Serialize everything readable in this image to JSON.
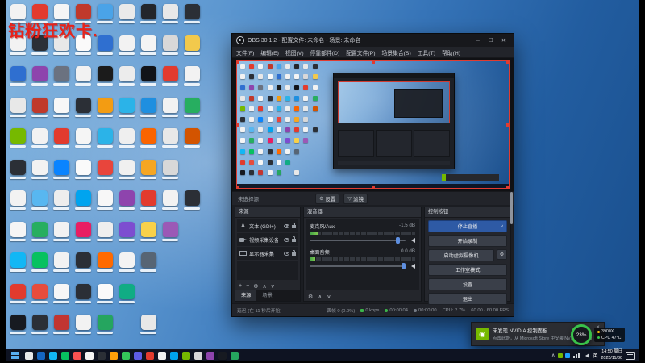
{
  "overlay": {
    "promo_text": "钻粉狂欢卡."
  },
  "desktop": {
    "icon_rows": [
      [
        "#f2f2f2",
        "#e23b2e",
        "#f5f5f5",
        "#c0392b",
        "#4aa3e8",
        "#eaeaea",
        "#23262b",
        "#e8e8e8",
        "#2b2f36",
        null
      ],
      [
        "#f2f2f2",
        "#2b2f36",
        "#e8e8e8",
        "#fafafa",
        "#2f6fd0",
        "#f2f2f2",
        "#f4f4f4",
        "#d8d8d8",
        "#f2c94c",
        null
      ],
      [
        "#2f6fd0",
        "#8e44ad",
        "#6b7280",
        "#f2f2f2",
        "#1b1b1b",
        "#ececec",
        "#111318",
        "#e23b2e",
        "#f2f2f2",
        null
      ],
      [
        "#e8e8e8",
        "#c0392b",
        "#f7f7f7",
        "#2b2f36",
        "#f39c12",
        "#2bb3e8",
        "#1f8fe0",
        "#f2f2f2",
        "#27ae60",
        null
      ],
      [
        "#76b900",
        "#f2f2f2",
        "#e23b2e",
        "#f5f5f5",
        "#2bb3e8",
        "#efefef",
        "#fa6400",
        "#e8e8e8",
        "#d35400",
        null
      ],
      [
        "#2b2f36",
        "#f2f2f2",
        "#0a84ff",
        "#fafafa",
        "#e8453c",
        "#f0f0f0",
        "#f5a623",
        "#d8d8d8",
        null,
        null
      ],
      [
        "#f2f2f2",
        "#58b7f0",
        "#ededed",
        "#00a4ef",
        "#f7f7f7",
        "#8e44ad",
        "#e23b2e",
        "#f2f2f2",
        "#2b2f36",
        null
      ],
      [
        "#f5f5f5",
        "#27ae60",
        "#f2f2f2",
        "#e91e63",
        "#eeeeee",
        "#7d4dd0",
        "#f8d14a",
        "#9b59b6",
        null,
        null
      ],
      [
        "#12b7f5",
        "#07c160",
        "#f2f2f2",
        "#2b2f36",
        "#ff6a00",
        "#f3f3f3",
        "#576574",
        null,
        null,
        null
      ],
      [
        "#e23b2e",
        "#e74c3c",
        "#f6f6f6",
        "#2b2f36",
        "#fafafa",
        "#10ac84",
        null,
        null,
        null,
        null
      ],
      [
        "#171a21",
        "#2b2f36",
        "#c23531",
        "#f2f2f2",
        "#25a55f",
        null,
        "#e8e8e8",
        null,
        null,
        null
      ]
    ]
  },
  "obs": {
    "title": "OBS 30.1.2 - 配置文件: 未命名 - 场景: 未命名",
    "window_controls": [
      {
        "name": "minimize-button",
        "glyph": "─"
      },
      {
        "name": "maximize-button",
        "glyph": "☐"
      },
      {
        "name": "close-button",
        "glyph": "✕"
      }
    ],
    "menu": [
      "文件(F)",
      "编辑(E)",
      "视图(V)",
      "停靠部件(D)",
      "配置文件(P)",
      "场景集合(S)",
      "工具(T)",
      "帮助(H)"
    ],
    "preview": {
      "no_source": "未选择源",
      "buttons": [
        {
          "name": "properties-button",
          "glyph": "⚙",
          "label": "设置"
        },
        {
          "name": "filters-button",
          "glyph": "▽",
          "label": "滤镜"
        }
      ]
    },
    "sources": {
      "title": "来源",
      "items": [
        {
          "icon": "text-source-icon",
          "type": "text",
          "label": "文本 (GDI+)"
        },
        {
          "icon": "camera-source-icon",
          "type": "cam",
          "label": "视频采集设备"
        },
        {
          "icon": "display-source-icon",
          "type": "display",
          "label": "显示器采集"
        }
      ],
      "toolbar": [
        {
          "name": "add-source-icon",
          "glyph": "+"
        },
        {
          "name": "remove-source-icon",
          "glyph": "−"
        },
        {
          "name": "source-properties-icon",
          "glyph": "⚙"
        },
        {
          "name": "move-source-up-icon",
          "glyph": "∧"
        },
        {
          "name": "move-source-down-icon",
          "glyph": "∨"
        }
      ],
      "tabs": [
        {
          "label": "来源",
          "active": true
        },
        {
          "label": "场景",
          "active": false
        }
      ]
    },
    "mixer": {
      "title": "混音器",
      "channels": [
        {
          "name": "麦克风/Aux",
          "db": "-1.5 dB",
          "meter": 8,
          "slider": 90
        },
        {
          "name": "桌面音频",
          "db": "0.0 dB",
          "meter": 5,
          "slider": 96
        }
      ],
      "toolbar": [
        {
          "name": "mixer-settings-icon",
          "glyph": "⚙"
        },
        {
          "name": "mixer-up-icon",
          "glyph": "∧"
        },
        {
          "name": "mixer-down-icon",
          "glyph": "∨"
        }
      ]
    },
    "controls": {
      "title": "控制按钮",
      "caret_glyph": "∨",
      "gear_glyph": "⚙",
      "buttons": [
        {
          "name": "stop-streaming-button",
          "label": "停止直播",
          "primary": true,
          "split": true
        },
        {
          "name": "start-recording-button",
          "label": "开始录制"
        },
        {
          "name": "virtual-camera-button",
          "label": "启动虚拟摄像机",
          "gear": true
        },
        {
          "name": "studio-mode-button",
          "label": "工作室模式"
        },
        {
          "name": "settings-button",
          "label": "设置"
        },
        {
          "name": "exit-button",
          "label": "退出"
        }
      ]
    },
    "status": {
      "latency": "延迟 (在 11 秒后开始)",
      "dropped": "丢帧 0 (0.0%)",
      "bitrate": "0 kbps",
      "stream_time": "00:00:04",
      "rec_time": "00:00:00",
      "cpu": "CPU: 2.7%",
      "fps": "60.00 / 60.00 FPS"
    }
  },
  "toast": {
    "title": "未发现 NVIDIA 控制面板",
    "body": "点击此处，从 Microsoft Store 中安装 NVIDIA 控制面板。",
    "icon_glyph": "◉",
    "close_glyph": "✕",
    "accent": "#76b900"
  },
  "perf": {
    "percent": "23%",
    "line1": "3900X",
    "line2": "CPU 47°C",
    "ring_color": "#39c24a"
  },
  "taskbar": {
    "chevron": "∧",
    "ime": "英",
    "time": "14:50 周日",
    "date": "2025/11/30",
    "icons": [
      "#e8e8e8",
      "#1565c0",
      "#12b7f5",
      "#07c160",
      "#fa5151",
      "#f5f5f5",
      "#2b2f36",
      "#ff9f0a",
      "#34c759",
      "#5e5ce6",
      "#e23b2e",
      "#f2f2f2",
      "#00a4ef",
      "#76b900",
      "#d8d8d8",
      "#8e44ad",
      "#171a21",
      "#25a55f"
    ],
    "tray_colors": [
      "#76b900",
      "#1e9fff"
    ]
  }
}
